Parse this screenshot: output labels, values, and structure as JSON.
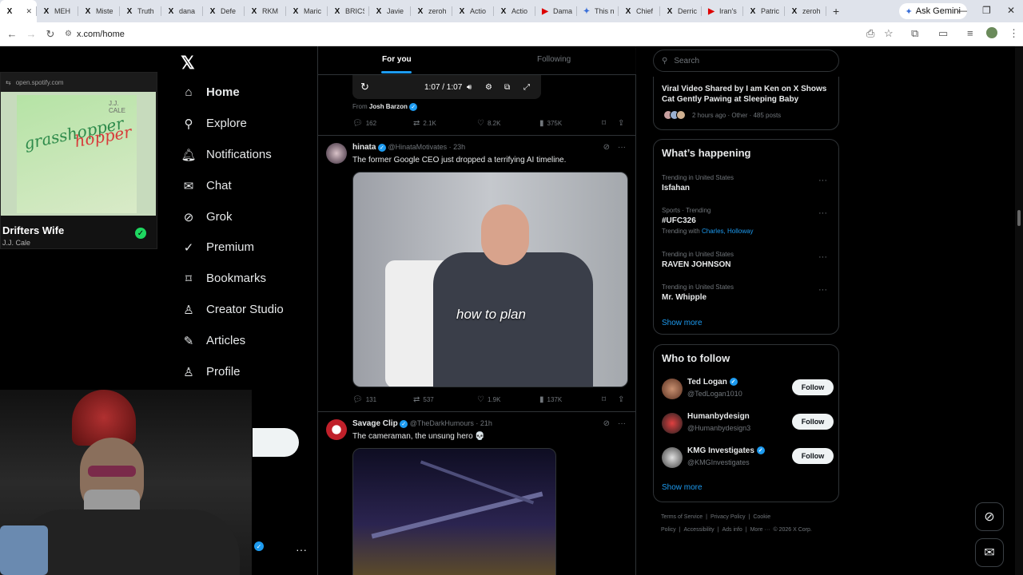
{
  "browser": {
    "tabs": [
      {
        "icon": "X",
        "label": "",
        "active": true
      },
      {
        "icon": "X",
        "label": "MEH"
      },
      {
        "icon": "X",
        "label": "Miste"
      },
      {
        "icon": "X",
        "label": "Truth"
      },
      {
        "icon": "X",
        "label": "dana"
      },
      {
        "icon": "X",
        "label": "Defe"
      },
      {
        "icon": "X",
        "label": "RKM"
      },
      {
        "icon": "X",
        "label": "Maric"
      },
      {
        "icon": "X",
        "label": "BRICS"
      },
      {
        "icon": "X",
        "label": "Javie"
      },
      {
        "icon": "X",
        "label": "zeroh"
      },
      {
        "icon": "X",
        "label": "Actio"
      },
      {
        "icon": "X",
        "label": "Actio"
      },
      {
        "icon": "▶",
        "label": "Dama",
        "color": "red"
      },
      {
        "icon": "✦",
        "label": "This n",
        "color": "blue"
      },
      {
        "icon": "X",
        "label": "Chief"
      },
      {
        "icon": "X",
        "label": "Derric"
      },
      {
        "icon": "▶",
        "label": "Iran's",
        "color": "red"
      },
      {
        "icon": "X",
        "label": "Patric"
      },
      {
        "icon": "X",
        "label": "zeroh"
      }
    ],
    "new_tab": "+",
    "gemini_label": "Ask Gemini",
    "url": "x.com/home"
  },
  "spotify": {
    "source": "open.spotify.com",
    "album_text_1": "grasshopper",
    "album_text_2": "hopper",
    "album_tag": "J.J. CALE",
    "song": "Drifters Wife",
    "artist": "J.J. Cale"
  },
  "nav": {
    "logo": "𝕏",
    "items": [
      {
        "label": "Home",
        "icon": "home-icon",
        "glyph": "⌂"
      },
      {
        "label": "Explore",
        "icon": "search-icon",
        "glyph": "⚲"
      },
      {
        "label": "Notifications",
        "icon": "bell-icon",
        "glyph": "🔔︎"
      },
      {
        "label": "Chat",
        "icon": "mail-icon",
        "glyph": "✉"
      },
      {
        "label": "Grok",
        "icon": "grok-icon",
        "glyph": "⊘"
      },
      {
        "label": "Premium",
        "icon": "premium-icon",
        "glyph": "✓"
      },
      {
        "label": "Bookmarks",
        "icon": "bookmark-icon",
        "glyph": "⌑"
      },
      {
        "label": "Creator Studio",
        "icon": "creator-icon",
        "glyph": "♙"
      },
      {
        "label": "Articles",
        "icon": "articles-icon",
        "glyph": "✎"
      },
      {
        "label": "Profile",
        "icon": "profile-icon",
        "glyph": "♙"
      }
    ],
    "more": "···"
  },
  "feed": {
    "tabs": {
      "for_you": "For you",
      "following": "Following"
    },
    "video_controls": {
      "time": "1:07 / 1:07"
    },
    "prev_post": {
      "from_label": "From",
      "from_name": "Josh Barzon",
      "replies": "162",
      "reposts": "2.1K",
      "likes": "8.2K",
      "views": "375K"
    },
    "post1": {
      "name": "hinata",
      "handle": "@HinataMotivates",
      "time": "· 23h",
      "text": "The former Google CEO just dropped a terrifying AI timeline.",
      "caption": "how to plan",
      "replies": "131",
      "reposts": "537",
      "likes": "1.9K",
      "views": "137K"
    },
    "post2": {
      "name": "Savage Clip",
      "handle": "@TheDarkHumours",
      "time": "· 21h",
      "text": "The cameraman, the unsung hero 💀"
    }
  },
  "right": {
    "search_placeholder": "Search",
    "news": {
      "title": "Viral Video Shared by I am Ken on X Shows Cat Gently Pawing at Sleeping Baby",
      "meta": "2 hours ago · Other · 485 posts"
    },
    "happening": {
      "title": "What’s happening",
      "trends": [
        {
          "category": "Trending in United States",
          "name": "Isfahan"
        },
        {
          "category": "Sports · Trending",
          "name": "#UFC326",
          "with_label": "Trending with",
          "with_links": "Charles, Holloway"
        },
        {
          "category": "Trending in United States",
          "name": "RAVEN JOHNSON"
        },
        {
          "category": "Trending in United States",
          "name": "Mr. Whipple"
        }
      ],
      "show_more": "Show more"
    },
    "who_to_follow": {
      "title": "Who to follow",
      "accounts": [
        {
          "name": "Ted Logan",
          "handle": "@TedLogan1010",
          "button": "Follow"
        },
        {
          "name": "Humanbydesign",
          "handle": "@Humanbydesign3",
          "button": "Follow"
        },
        {
          "name": "KMG Investigates",
          "handle": "@KMGInvestigates",
          "button": "Follow"
        }
      ],
      "show_more": "Show more"
    },
    "footer": {
      "links": [
        "Terms of Service",
        "|",
        "Privacy Policy",
        "|",
        "Cookie Policy",
        "|",
        "Accessibility",
        "|",
        "Ads info",
        "|",
        "More ···",
        "© 2026 X Corp."
      ]
    }
  },
  "colors": {
    "accent": "#1d9bf0",
    "background": "#000000",
    "spotify_green": "#1ed760"
  }
}
